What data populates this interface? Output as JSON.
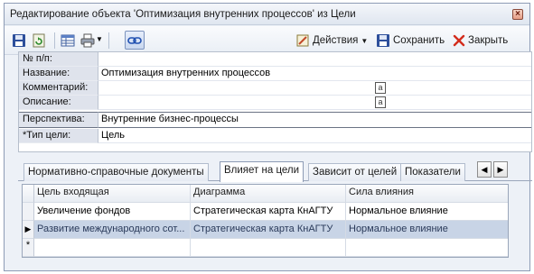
{
  "window": {
    "title": "Редактирование объекта 'Оптимизация внутренних процессов' из Цели",
    "close_glyph": "×"
  },
  "toolbar": {
    "actions_label": "Действия",
    "save_label": "Сохранить",
    "close_label": "Закрыть",
    "icons": [
      "save-icon",
      "refresh-icon",
      "table-icon",
      "print-icon",
      "link-icon",
      "actions-icon",
      "save-disk-icon",
      "close-x-icon"
    ]
  },
  "form": {
    "fields": [
      {
        "label": "№ п/п:",
        "value": ""
      },
      {
        "label": "Название:",
        "value": "Оптимизация внутренних процессов"
      },
      {
        "label": "Комментарий:",
        "value": "",
        "editor_glyph": "a"
      },
      {
        "label": "Описание:",
        "value": "",
        "editor_glyph": "a"
      },
      {
        "label": "Перспектива:",
        "value": "Внутренние бизнес-процессы"
      },
      {
        "label": "*Тип цели:",
        "value": "Цель"
      }
    ]
  },
  "tabs": [
    {
      "label": "Нормативно-справочные документы",
      "selected": false
    },
    {
      "label": "Влияет на цели",
      "selected": true
    },
    {
      "label": "Зависит от целей",
      "selected": false
    },
    {
      "label": "Показатели",
      "selected": false
    }
  ],
  "tab_scroll": {
    "left": "◀",
    "right": "▶"
  },
  "grid": {
    "columns": [
      "Цель входящая",
      "Диаграмма",
      "Сила влияния"
    ],
    "rows": [
      {
        "indicator": "",
        "cells": [
          "Увеличение фондов",
          "Стратегическая карта КнАГТУ",
          "Нормальное влияние"
        ]
      },
      {
        "indicator": "▶",
        "cells": [
          "Развитие международного сот...",
          "Стратегическая карта КнАГТУ",
          "Нормальное влияние"
        ],
        "selected": true
      },
      {
        "indicator": "*",
        "cells": [
          "",
          "",
          ""
        ]
      }
    ]
  },
  "colors": {
    "accent": "#4a6fb5",
    "label_bg": "#dfe3ec",
    "selected_row": "#c8d4e6",
    "window_bg": "#edf1f7"
  }
}
